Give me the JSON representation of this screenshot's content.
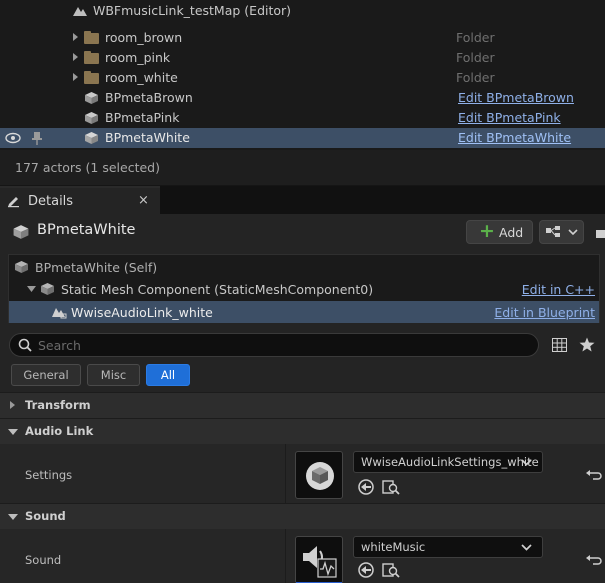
{
  "outliner": {
    "map_name": "WBFmusicLink_testMap (Editor)",
    "rows": [
      {
        "label": "room_brown",
        "type": "Folder"
      },
      {
        "label": "room_pink",
        "type": "Folder"
      },
      {
        "label": "room_white",
        "type": "Folder"
      },
      {
        "label": "BPmetaBrown",
        "edit": "Edit BPmetaBrown"
      },
      {
        "label": "BPmetaPink",
        "edit": "Edit BPmetaPink"
      },
      {
        "label": "BPmetaWhite",
        "edit": "Edit BPmetaWhite"
      }
    ],
    "status": "177 actors (1 selected)"
  },
  "details_tab": {
    "label": "Details",
    "close": "×"
  },
  "details": {
    "actor_name": "BPmetaWhite",
    "add_label": "Add",
    "components": [
      {
        "label": "BPmetaWhite (Self)"
      },
      {
        "label": "Static Mesh Component (StaticMeshComponent0)",
        "link": "Edit in C++"
      },
      {
        "label": "WwiseAudioLink_white",
        "link": "Edit in Blueprint"
      }
    ],
    "search_placeholder": "Search",
    "filters": [
      "General",
      "Misc",
      "All"
    ],
    "active_filter": "All",
    "categories": {
      "transform": "Transform",
      "audio_link": "Audio Link",
      "sound": "Sound"
    },
    "props": {
      "settings": {
        "name": "Settings",
        "value": "WwiseAudioLinkSettings_white"
      },
      "sound": {
        "name": "Sound",
        "value": "whiteMusic"
      }
    }
  },
  "colors": {
    "selection": "#3d4f66",
    "accent": "#1f6fd8",
    "link": "#8fb0e8",
    "add_plus": "#5bb04a"
  }
}
